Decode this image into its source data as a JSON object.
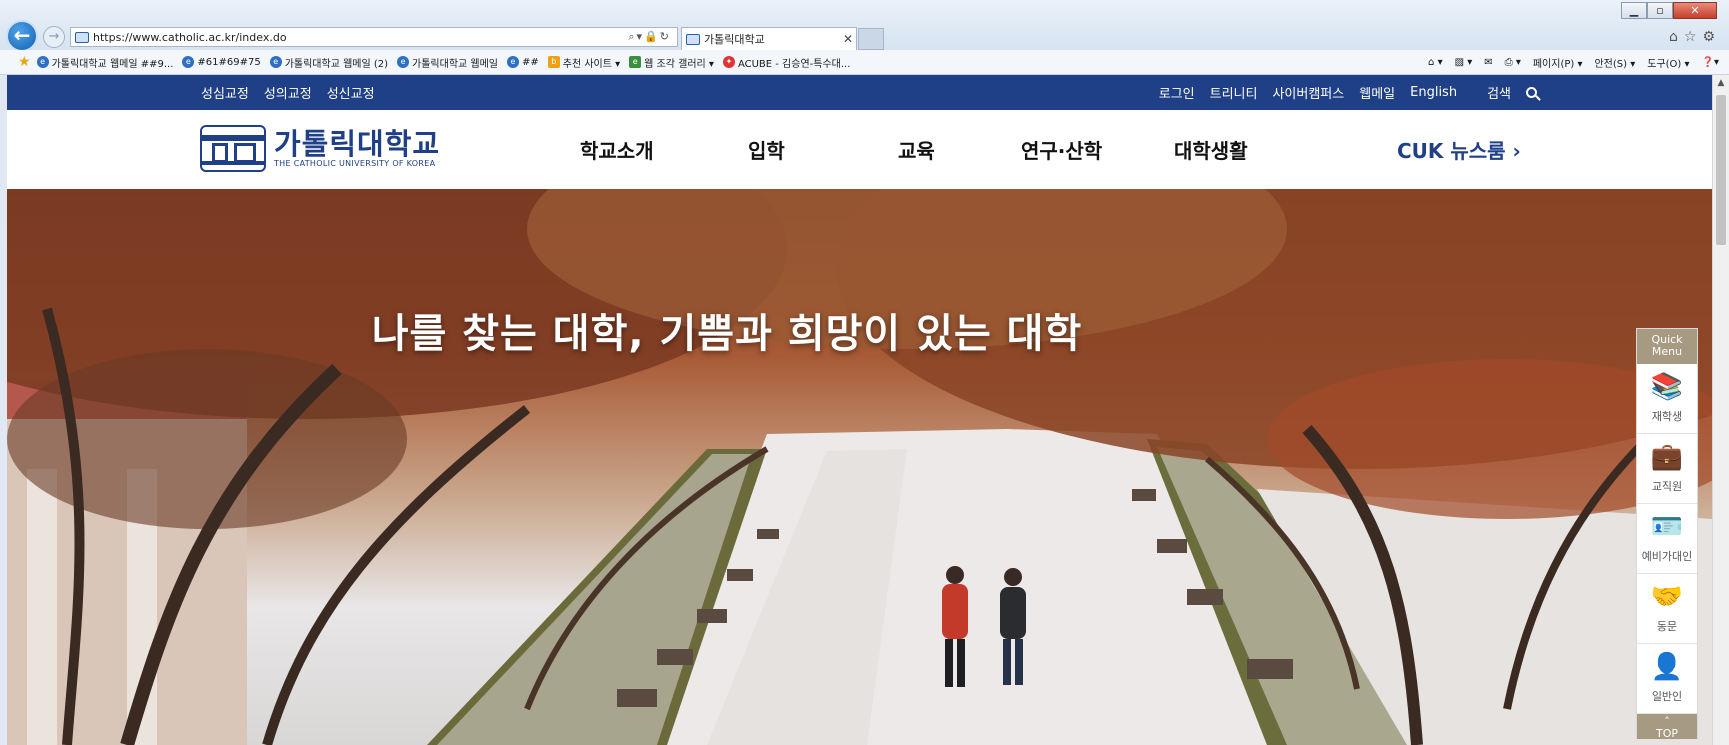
{
  "browser": {
    "url": "https://www.catholic.ac.kr/index.do",
    "tab_title": "가톨릭대학교",
    "window_min": "▁",
    "window_max": "▫",
    "window_close": "✕",
    "favorites": [
      {
        "label": "가톨릭대학교 웹메일 ##9..."
      },
      {
        "label": "#61#69#75"
      },
      {
        "label": "가톨릭대학교 웹메일 (2)"
      },
      {
        "label": "가톨릭대학교 웹메일"
      },
      {
        "label": "##"
      },
      {
        "label": "추천 사이트 ▾"
      },
      {
        "label": "웹 조각 갤러리 ▾"
      },
      {
        "label": "ACUBE - 김승연-특수대..."
      }
    ],
    "commands": [
      "페이지(P) ▾",
      "안전(S) ▾",
      "도구(O) ▾"
    ]
  },
  "util_nav": {
    "left": [
      "성심교정",
      "성의교정",
      "성신교정"
    ],
    "right": [
      "로그인",
      "트리니티",
      "사이버캠퍼스",
      "웹메일",
      "English",
      "검색"
    ]
  },
  "header": {
    "logo_ko": "가톨릭대학교",
    "logo_en": "THE CATHOLIC UNIVERSITY OF KOREA",
    "gnb": [
      "학교소개",
      "입학",
      "교육",
      "연구·산학",
      "대학생활"
    ],
    "newsroom": "CUK 뉴스룸 ›"
  },
  "hero": {
    "headline": "나를 찾는 대학, 기쁨과 희망이 있는 대학"
  },
  "quick_menu": {
    "title": "Quick Menu",
    "items": [
      {
        "label": "재학생",
        "icon": "book-stack-icon"
      },
      {
        "label": "교직원",
        "icon": "briefcase-icon"
      },
      {
        "label": "예비가대인",
        "icon": "id-card-icon"
      },
      {
        "label": "동문",
        "icon": "handshake-icon"
      },
      {
        "label": "일반인",
        "icon": "person-icon"
      }
    ],
    "top_label": "TOP"
  }
}
